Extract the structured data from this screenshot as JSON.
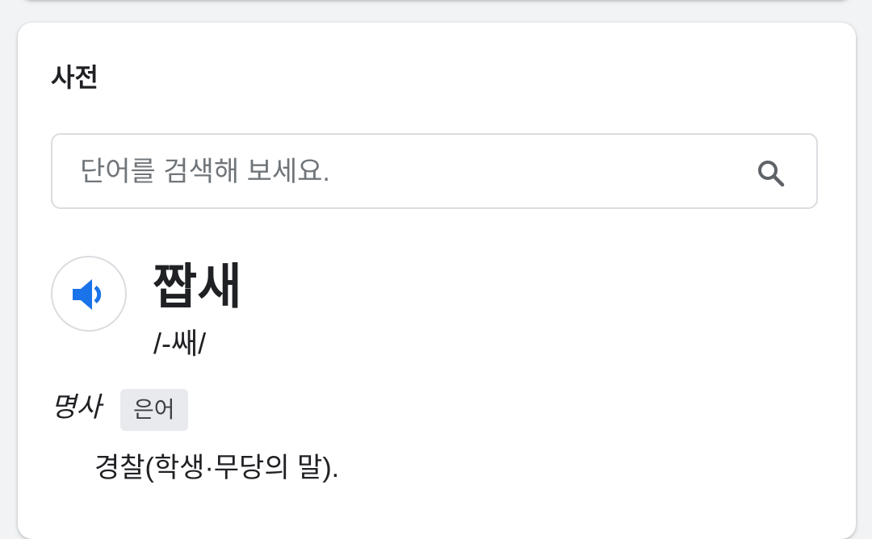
{
  "dictionary": {
    "title": "사전",
    "search": {
      "placeholder": "단어를 검색해 보세요.",
      "value": ""
    },
    "entry": {
      "word": "짭새",
      "pronunciation": "/-쌔/",
      "part_of_speech": "명사",
      "tag": "은어",
      "definition": "경찰(학생·무당의 말)."
    }
  },
  "icons": {
    "search": "search-icon",
    "speaker": "speaker-icon"
  },
  "colors": {
    "accent": "#1a73e8",
    "text": "#202124",
    "border": "#dadce0",
    "badge_bg": "#e8eaed"
  }
}
